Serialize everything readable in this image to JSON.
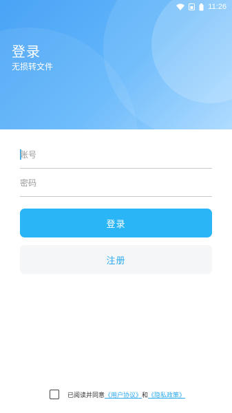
{
  "status_bar": {
    "time": "11:26"
  },
  "header": {
    "title": "登录",
    "subtitle": "无损转文件"
  },
  "form": {
    "account_placeholder": "账号",
    "password_placeholder": "密码",
    "login_label": "登录",
    "register_label": "注册"
  },
  "agreement": {
    "prefix": "已阅读并同意",
    "user_agreement": "《用户协议》",
    "and": "和",
    "privacy_policy": "《隐私政策》",
    "checked": false
  },
  "colors": {
    "accent": "#2ab5f6",
    "header_gradient_start": "#4aa3f5",
    "header_gradient_end": "#a7d8ff",
    "register_bg": "#f5f6f8"
  }
}
